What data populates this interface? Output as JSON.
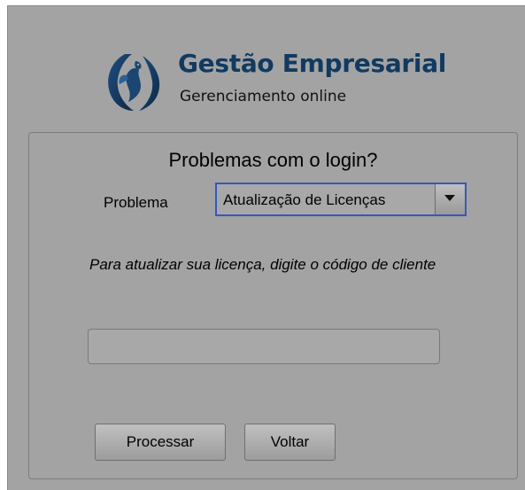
{
  "brand": {
    "title": "Gestão Empresarial",
    "subtitle": "Gerenciamento online",
    "title_color": "#123a60"
  },
  "panel": {
    "title": "Problemas com o login?",
    "problem_label": "Problema",
    "problem_select": {
      "selected": "Atualização de Licenças"
    },
    "instruction": "Para atualizar sua licença, digite o código de cliente",
    "client_code": {
      "value": "",
      "placeholder": ""
    },
    "buttons": {
      "process": "Processar",
      "back": "Voltar"
    }
  },
  "colors": {
    "background": "#a3a3a3",
    "select_focus": "#3858b7"
  }
}
